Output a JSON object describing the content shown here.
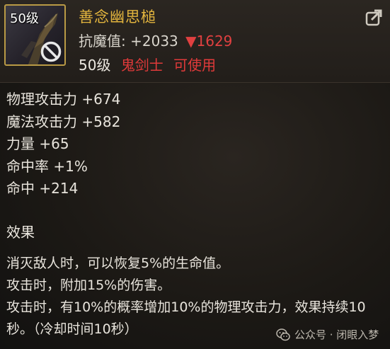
{
  "item": {
    "icon_level": "50级",
    "name": "善念幽思槌",
    "stat_label": "抗魔值:",
    "stat_value": "+2033",
    "stat_delta": "▼1629",
    "req_level": "50级",
    "req_class": "鬼剑士",
    "req_usable": "可使用"
  },
  "attributes": [
    "物理攻击力 +674",
    "魔法攻击力 +582",
    "力量 +65",
    "命中率 +1%",
    "命中 +214"
  ],
  "effects_section": {
    "title": "效果",
    "lines": [
      "消灭敌人时，可以恢复5%的生命值。",
      "攻击时，附加15%的伤害。",
      "攻击时，有10%的概率增加10%的物理攻击力，效果持续10",
      "秒。（冷却时间10秒）"
    ]
  },
  "watermark": {
    "text": "公众号 · 闭眼入梦"
  },
  "icons": {
    "forbid": "forbidden-icon",
    "share": "share-icon",
    "wechat": "wechat-icon"
  },
  "colors": {
    "item_name": "#e3b53e",
    "delta_red": "#e04040",
    "class_red": "#e03a3a",
    "icon_border": "#b99a45"
  }
}
